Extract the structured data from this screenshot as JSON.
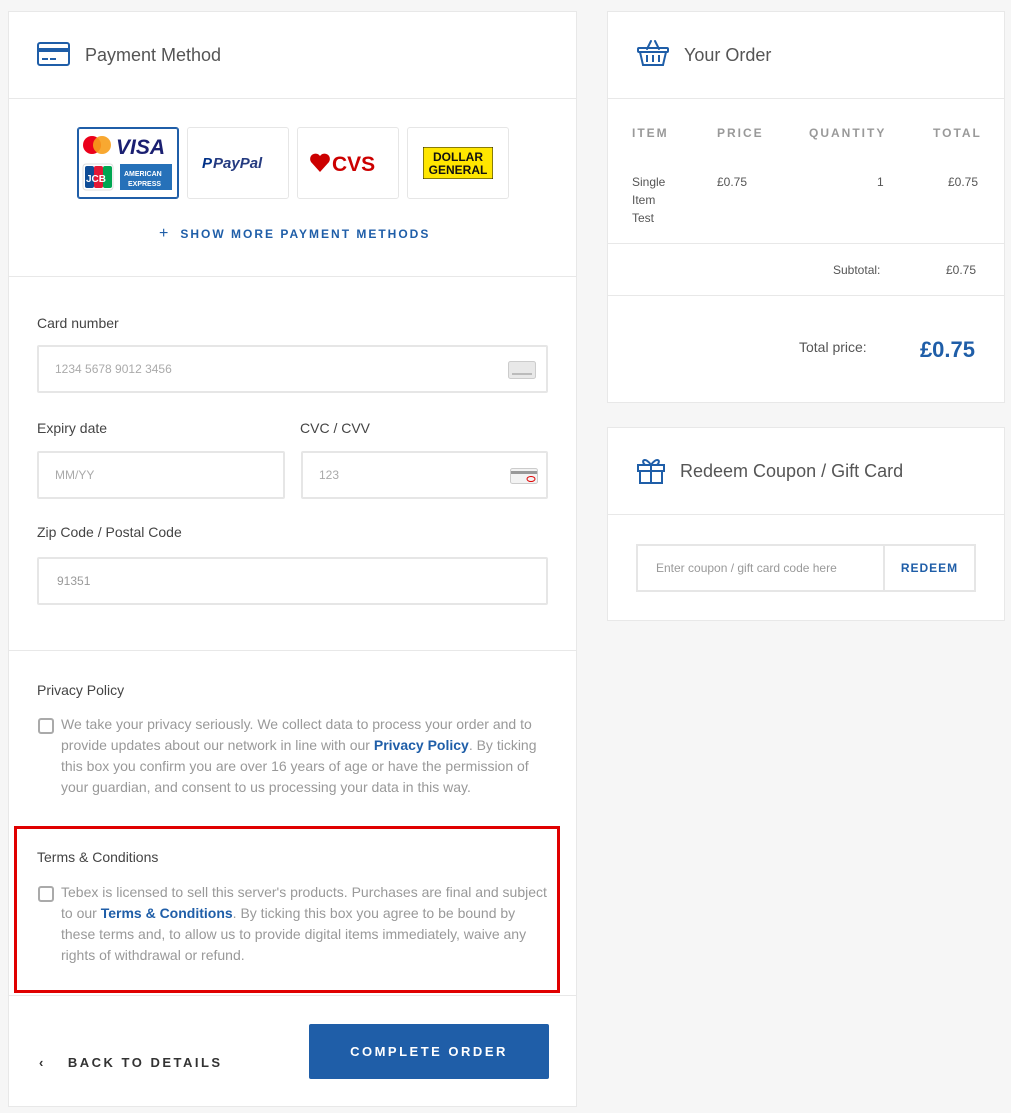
{
  "payment": {
    "title": "Payment Method",
    "methods": [
      {
        "name": "Cards (Mastercard, Visa, JCB, American Express)",
        "visa_text": "VISA",
        "jcb_text": "JCB",
        "amex_text": "AMERICAN EXPRESS",
        "selected": true
      },
      {
        "name": "PayPal",
        "text": "PayPal",
        "color": "#253b80"
      },
      {
        "name": "CVS",
        "text": "CVS",
        "color": "#cc0000"
      },
      {
        "name": "Dollar General",
        "text1": "DOLLAR",
        "text2": "GENERAL",
        "color": "#ffe600"
      }
    ],
    "show_more_label": "SHOW MORE PAYMENT METHODS"
  },
  "form": {
    "card_number_label": "Card number",
    "card_number_placeholder": "1234 5678 9012 3456",
    "expiry_label": "Expiry date",
    "expiry_placeholder": "MM/YY",
    "cvc_label": "CVC / CVV",
    "cvc_placeholder": "123",
    "zip_label": "Zip Code / Postal Code",
    "zip_value": "91351"
  },
  "privacy": {
    "title": "Privacy Policy",
    "text_before": "We take your privacy seriously. We collect data to process your order and to provide updates about our network in line with our ",
    "link": "Privacy Policy",
    "text_after": ". By ticking this box you confirm you are over 16 years of age or have the permission of your guardian, and consent to us processing your data in this way."
  },
  "terms": {
    "title": "Terms & Conditions",
    "text_before": "Tebex is licensed to sell this server's products. Purchases are final and subject to our ",
    "link": "Terms & Conditions",
    "text_after": ". By ticking this box you agree to be bound by these terms and, to allow us to provide digital items immediately, waive any rights of withdrawal or refund."
  },
  "actions": {
    "back_label": "BACK TO DETAILS",
    "complete_label": "COMPLETE ORDER"
  },
  "order": {
    "title": "Your Order",
    "columns": [
      "ITEM",
      "PRICE",
      "QUANTITY",
      "TOTAL"
    ],
    "item": {
      "name_lines": [
        "Single",
        "Item",
        "Test"
      ],
      "price": "£0.75",
      "quantity": "1",
      "total": "£0.75"
    },
    "subtotal_label": "Subtotal:",
    "subtotal_value": "£0.75",
    "total_label": "Total price:",
    "total_value": "£0.75"
  },
  "coupon": {
    "title": "Redeem Coupon / Gift Card",
    "placeholder": "Enter coupon / gift card code here",
    "button_label": "REDEEM"
  },
  "colors": {
    "accent": "#1f5ea8",
    "highlight": "#e00000"
  }
}
